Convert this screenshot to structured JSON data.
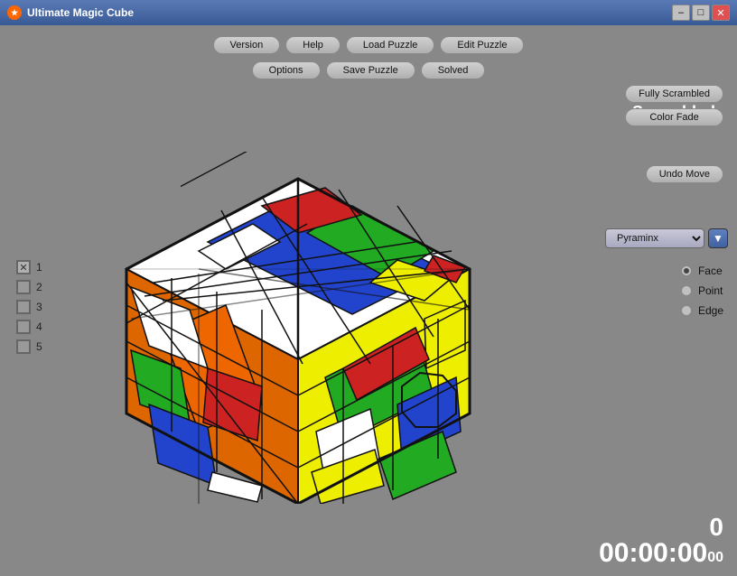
{
  "titlebar": {
    "title": "Ultimate Magic Cube",
    "icon": "★",
    "minimize": "–",
    "maximize": "□",
    "close": "✕"
  },
  "toolbar": {
    "row1": [
      {
        "label": "Version",
        "name": "version-button"
      },
      {
        "label": "Help",
        "name": "help-button"
      },
      {
        "label": "Load Puzzle",
        "name": "load-puzzle-button"
      },
      {
        "label": "Edit Puzzle",
        "name": "edit-puzzle-button"
      }
    ],
    "row2": [
      {
        "label": "Options",
        "name": "options-button"
      },
      {
        "label": "Save Puzzle",
        "name": "save-puzzle-button"
      },
      {
        "label": "Solved",
        "name": "solved-button"
      }
    ]
  },
  "right_panel": {
    "buttons": [
      {
        "label": "Fully Scrambled",
        "name": "fully-scrambled-button"
      },
      {
        "label": "Color Fade",
        "name": "color-fade-button"
      }
    ],
    "undo_label": "Undo Move",
    "scrambled_label": "Scrambled",
    "puzzle_name": "Pyraminx",
    "radio_options": [
      {
        "label": "Face",
        "name": "face-radio",
        "selected": true
      },
      {
        "label": "Point",
        "name": "point-radio",
        "selected": false
      },
      {
        "label": "Edge",
        "name": "edge-radio",
        "selected": false
      }
    ]
  },
  "left_panel": {
    "layers": [
      {
        "num": "1",
        "checked": true,
        "name": "layer-1"
      },
      {
        "num": "2",
        "checked": false,
        "name": "layer-2"
      },
      {
        "num": "3",
        "checked": false,
        "name": "layer-3"
      },
      {
        "num": "4",
        "checked": false,
        "name": "layer-4"
      },
      {
        "num": "5",
        "checked": false,
        "name": "layer-5"
      }
    ]
  },
  "counter": {
    "moves": "0",
    "timer": "00:00:00",
    "timer_small": "00"
  }
}
